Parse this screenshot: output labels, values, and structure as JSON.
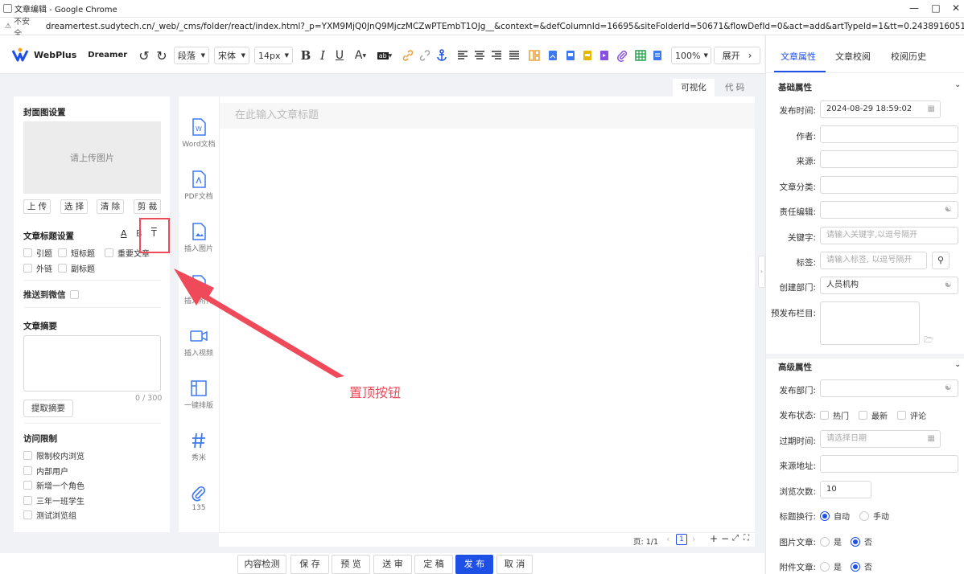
{
  "window": {
    "title": "文章编辑 - Google Chrome"
  },
  "address_bar": {
    "security": "不安全",
    "url": "dreamertest.sudytech.cn/_web/_cms/folder/react/index.html?_p=YXM9MjQ0JnQ9MjczMCZwPTEmbT1OJg__&context=&defColumnId=16695&siteFolderId=50671&flowDefId=0&act=add&artTypeId=1&tt=0.24389160514511565"
  },
  "toolbar": {
    "logo": "WebPlus",
    "logo_sub": "Dreamer",
    "paragraph": "段落",
    "font": "宋体",
    "size": "14px",
    "bold": "B",
    "italic": "I",
    "underline": "U",
    "zoom": "100%",
    "expand": "展开"
  },
  "view_tabs": {
    "visual": "可视化",
    "code": "代 码"
  },
  "left": {
    "cover_title": "封面图设置",
    "upload_placeholder": "请上传图片",
    "buttons": [
      "上 传",
      "选 择",
      "清 除",
      "剪 裁"
    ],
    "title_settings": "文章标题设置",
    "title_icons": [
      "A",
      "B",
      "T"
    ],
    "title_checks": [
      "引题",
      "短标题",
      "重要文章",
      "外链",
      "副标题"
    ],
    "wechat": "推送到微信",
    "summary_title": "文章摘要",
    "summary_count": "0 / 300",
    "extract_btn": "提取摘要",
    "access_title": "访问限制",
    "access_items": [
      "限制校内浏览",
      "内部用户",
      "新增一个角色",
      "三年一班学生",
      "测试浏览组"
    ]
  },
  "insert_bar": [
    {
      "label": "Word文档",
      "icon": "word-doc-icon"
    },
    {
      "label": "PDF文档",
      "icon": "pdf-doc-icon"
    },
    {
      "label": "插入图片",
      "icon": "image-icon"
    },
    {
      "label": "插入附件",
      "icon": "attachment-icon"
    },
    {
      "label": "插入视频",
      "icon": "video-icon"
    },
    {
      "label": "一键排版",
      "icon": "layout-icon"
    },
    {
      "label": "秀米",
      "icon": "hash-icon"
    },
    {
      "label": "135",
      "icon": "paperclip-icon"
    }
  ],
  "editor": {
    "title_placeholder": "在此输入文章标题",
    "page_label": "页: 1/1",
    "page_num": "1"
  },
  "annotation": {
    "label": "置顶按钮",
    "color": "#ef4a5a"
  },
  "footer_buttons": [
    "内容检测",
    "保 存",
    "预 览",
    "送 审",
    "定 稿",
    "发 布",
    "取 消"
  ],
  "right": {
    "tabs": [
      "文章属性",
      "文章校阅",
      "校阅历史"
    ],
    "basic_title": "基础属性",
    "publish_time_label": "发布时间:",
    "publish_time": "2024-08-29 18:59:02",
    "author_label": "作者:",
    "source_label": "来源:",
    "category_label": "文章分类:",
    "editor_label": "责任编辑:",
    "keywords_label": "关键字:",
    "keywords_ph": "请输入关键字,以逗号隔开",
    "tags_label": "标签:",
    "tags_ph": "请输入标签, 以逗号隔开",
    "dept_label": "创建部门:",
    "dept_value": "人员机构",
    "pre_column_label": "预发布栏目:",
    "advanced_title": "高级属性",
    "pub_dept_label": "发布部门:",
    "pub_status_label": "发布状态:",
    "status_items": [
      "热门",
      "最新",
      "评论"
    ],
    "expire_label": "过期时间:",
    "expire_ph": "请选择日期",
    "source_url_label": "来源地址:",
    "views_label": "浏览次数:",
    "views_value": "10",
    "wrap_label": "标题换行:",
    "wrap_options": [
      "自动",
      "手动"
    ],
    "img_article_label": "图片文章:",
    "att_article_label": "附件文章:",
    "yes": "是",
    "no": "否"
  },
  "colors": {
    "accent": "#1e50e6",
    "annotation": "#ef4a5a"
  }
}
